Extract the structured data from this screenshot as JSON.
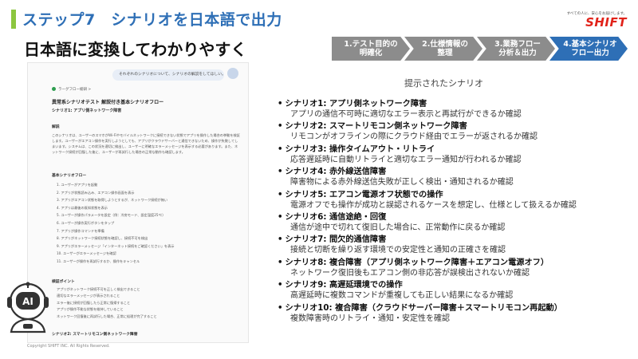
{
  "header": {
    "step_title": "ステップ7　シナリオを日本語で出力",
    "subtitle": "日本語に変換してわかりやすく"
  },
  "logo": {
    "tagline": "すべての人に、安心をお届けします。",
    "brand": "SHIFT"
  },
  "flow": [
    {
      "line1": "1.テスト目的の",
      "line2": "明確化"
    },
    {
      "line1": "2.仕様情報の",
      "line2": "整理"
    },
    {
      "line1": "3.業務フロー",
      "line2": "分析＆出力"
    },
    {
      "line1": "4.基本シナリオ",
      "line2": "フロー出力"
    }
  ],
  "chat": {
    "user_message": "それぞれのシナリオについて、シナリオの解説をしてほしい。",
    "bot_tag": "ラーグフロー総研 >",
    "doc_title": "異常系シナリオテスト 解説付き基本シナリオフロー",
    "doc_h2": "シナリオ1: アプリ側ネットワーク障害",
    "section_explain": "解説",
    "explain_text": "このシナリオは、ユーザーのスマホがWi-Fiやモバイルネットワークに接続できない状態でアプリを操作した場合の挙動を検証します。ユーザーがエアコン操作を実行しようとしても、アプリがクラウドサーバーと通信できないため、操作が失敗してしまいます。システムは、この状況を適切に検出し、ユーザーに明確なエラーメッセージを表示する必要があります。また、ネットワーク接続が回復した後に、ユーザーが再試行した場合の正常な動作も確認します。",
    "section_flow": "基本シナリオフロー",
    "flow_steps": [
      "1. ユーザーがアプリを起動",
      "2. アプリが状態読み込み、エアコン操作画面を表示",
      "3. アプリがエアコン状態を取得しようとするが、ネットワーク接続が無い",
      "4. アプリは最後の既知状態を表示",
      "5. ユーザーが操作パラメータを設定（例：冷房モード、設定温度25℃）",
      "6. ユーザーが操作実行ボタンをタップ",
      "7. アプリが操作コマンドを準備",
      "8. アプリがネットワーク接続状態を確認し、接続不可を検出",
      "9. アプリがエラーメッセージ「インターネット接続をご確認ください」を表示",
      "10. ユーザーがエラーメッセージを確認",
      "11. ユーザーが操作を再試行するか、操作をキャンセル"
    ],
    "section_points": "検証ポイント",
    "points": [
      "アプリがネットワーク接続不可を正しく検出できること",
      "適切なエラーメッセージが表示されること",
      "エラー後に接続が回復したら正常に復帰すること",
      "アプリが操作不能な状態を維持していること",
      "ネットワーク回復後に再試行した場合、正常に処理が完了すること"
    ],
    "footer_scenario": "シナリオ2: スマートリモコン側ネットワーク障害"
  },
  "right": {
    "heading": "提示されたシナリオ",
    "scenarios": [
      {
        "title": "シナリオ1: アプリ側ネットワーク障害",
        "desc": "アプリの通信不可時に適切なエラー表示と再試行ができるか確認"
      },
      {
        "title": "シナリオ2: スマートリモコン側ネットワーク障害",
        "desc": "リモコンがオフラインの際にクラウド経由でエラーが返されるか確認"
      },
      {
        "title": "シナリオ3: 操作タイムアウト・リトライ",
        "desc": "応答遅延時に自動リトライと適切なエラー通知が行われるか確認"
      },
      {
        "title": "シナリオ4: 赤外線送信障害",
        "desc": "障害物による赤外線送信失敗が正しく検出・通知されるか確認"
      },
      {
        "title": "シナリオ5: エアコン電源オフ状態での操作",
        "desc": "電源オフでも操作が成功と誤認されるケースを想定し、仕様として扱えるか確認"
      },
      {
        "title": "シナリオ6: 通信途絶・回復",
        "desc": "通信が途中で切れて復旧した場合に、正常動作に戻るか確認"
      },
      {
        "title": "シナリオ7: 間欠的通信障害",
        "desc": "接続と切断を繰り返す環境での安定性と通知の正確さを確認"
      },
      {
        "title": "シナリオ8: 複合障害（アプリ側ネットワーク障害＋エアコン電源オフ）",
        "desc": "ネットワーク復旧後もエアコン側の非応答が誤検出されないか確認"
      },
      {
        "title": "シナリオ9: 高遅延環境での操作",
        "desc": "高遅延時に複数コマンドが重複しても正しい結果になるか確認"
      },
      {
        "title": "シナリオ10: 複合障害（クラウドサーバー障害＋スマートリモコン再起動）",
        "desc": "複数障害時のリトライ・通知・安定性を確認"
      }
    ]
  },
  "robot": {
    "label": "AI"
  },
  "footer": {
    "copyright": "Copyright SHIFT INC. All Rights Reserved."
  },
  "colors": {
    "accent_green": "#8cc63f",
    "title_blue": "#2e6fb6",
    "chevron_grey": "#8c8c8c",
    "brand_red": "#e1231a"
  }
}
